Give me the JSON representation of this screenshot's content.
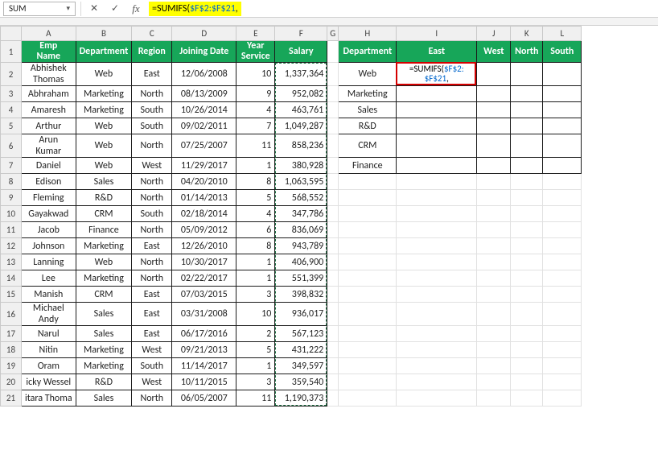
{
  "formula_bar": {
    "namebox": "SUM",
    "cancel_glyph": "✕",
    "accept_glyph": "✓",
    "fx_glyph": "fx",
    "formula_prefix": "=SUMIFS(",
    "formula_ref": "$F$2:$F$21",
    "formula_suffix": ","
  },
  "columns": [
    "A",
    "B",
    "C",
    "D",
    "E",
    "F",
    "G",
    "H",
    "I",
    "J",
    "K",
    "L"
  ],
  "t1_headers": {
    "A": "Emp Name",
    "B": "Department",
    "C": "Region",
    "D": "Joining Date",
    "E": "Year Service",
    "F": "Salary"
  },
  "t1_rows": [
    {
      "r": 2,
      "A": "Abhishek Thomas",
      "B": "Web",
      "C": "East",
      "D": "12/06/2008",
      "E": "10",
      "F": "1,337,364",
      "tall": true
    },
    {
      "r": 3,
      "A": "Abhraham",
      "B": "Marketing",
      "C": "North",
      "D": "08/13/2009",
      "E": "9",
      "F": "952,082"
    },
    {
      "r": 4,
      "A": "Amaresh",
      "B": "Marketing",
      "C": "South",
      "D": "10/26/2014",
      "E": "4",
      "F": "463,761"
    },
    {
      "r": 5,
      "A": "Arthur",
      "B": "Web",
      "C": "South",
      "D": "09/02/2011",
      "E": "7",
      "F": "1,049,287"
    },
    {
      "r": 6,
      "A": "Arun Kumar",
      "B": "Web",
      "C": "North",
      "D": "07/25/2007",
      "E": "11",
      "F": "858,236",
      "tall": true
    },
    {
      "r": 7,
      "A": "Daniel",
      "B": "Web",
      "C": "West",
      "D": "11/29/2017",
      "E": "1",
      "F": "380,928"
    },
    {
      "r": 8,
      "A": "Edison",
      "B": "Sales",
      "C": "North",
      "D": "04/20/2010",
      "E": "8",
      "F": "1,063,595"
    },
    {
      "r": 9,
      "A": "Fleming",
      "B": "R&D",
      "C": "North",
      "D": "01/14/2013",
      "E": "5",
      "F": "568,552"
    },
    {
      "r": 10,
      "A": "Gayakwad",
      "B": "CRM",
      "C": "South",
      "D": "02/18/2014",
      "E": "4",
      "F": "347,786"
    },
    {
      "r": 11,
      "A": "Jacob",
      "B": "Finance",
      "C": "North",
      "D": "05/09/2012",
      "E": "6",
      "F": "836,069"
    },
    {
      "r": 12,
      "A": "Johnson",
      "B": "Marketing",
      "C": "East",
      "D": "12/26/2010",
      "E": "8",
      "F": "943,789"
    },
    {
      "r": 13,
      "A": "Lanning",
      "B": "Web",
      "C": "North",
      "D": "10/30/2017",
      "E": "1",
      "F": "406,900"
    },
    {
      "r": 14,
      "A": "Lee",
      "B": "Marketing",
      "C": "North",
      "D": "02/22/2017",
      "E": "1",
      "F": "551,399"
    },
    {
      "r": 15,
      "A": "Manish",
      "B": "CRM",
      "C": "East",
      "D": "07/03/2015",
      "E": "3",
      "F": "398,832"
    },
    {
      "r": 16,
      "A": "Michael Andy",
      "B": "Sales",
      "C": "East",
      "D": "03/31/2008",
      "E": "10",
      "F": "936,017",
      "tall": true
    },
    {
      "r": 17,
      "A": "Narul",
      "B": "Sales",
      "C": "East",
      "D": "06/17/2016",
      "E": "2",
      "F": "567,123"
    },
    {
      "r": 18,
      "A": "Nitin",
      "B": "Marketing",
      "C": "West",
      "D": "09/21/2013",
      "E": "5",
      "F": "431,222"
    },
    {
      "r": 19,
      "A": "Oram",
      "B": "Marketing",
      "C": "South",
      "D": "11/14/2017",
      "E": "1",
      "F": "349,597"
    },
    {
      "r": 20,
      "A": "icky Wessel",
      "B": "R&D",
      "C": "West",
      "D": "10/11/2015",
      "E": "3",
      "F": "359,540"
    },
    {
      "r": 21,
      "A": "itara Thoma",
      "B": "Sales",
      "C": "North",
      "D": "06/05/2007",
      "E": "11",
      "F": "1,190,373"
    }
  ],
  "t2_headers": {
    "H": "Department",
    "I": "East",
    "J": "West",
    "K": "North",
    "L": "South"
  },
  "t2_rows": [
    {
      "r": 2,
      "H": "Web",
      "tall": true,
      "formula": true
    },
    {
      "r": 3,
      "H": "Marketing"
    },
    {
      "r": 4,
      "H": "Sales"
    },
    {
      "r": 5,
      "H": "R&D"
    },
    {
      "r": 6,
      "H": "CRM",
      "tall": true
    },
    {
      "r": 7,
      "H": "Finance"
    }
  ],
  "cell_formula": {
    "prefix": "=SUMIFS(",
    "ref": "$F$2:\n$F$21",
    "suffix": ","
  }
}
